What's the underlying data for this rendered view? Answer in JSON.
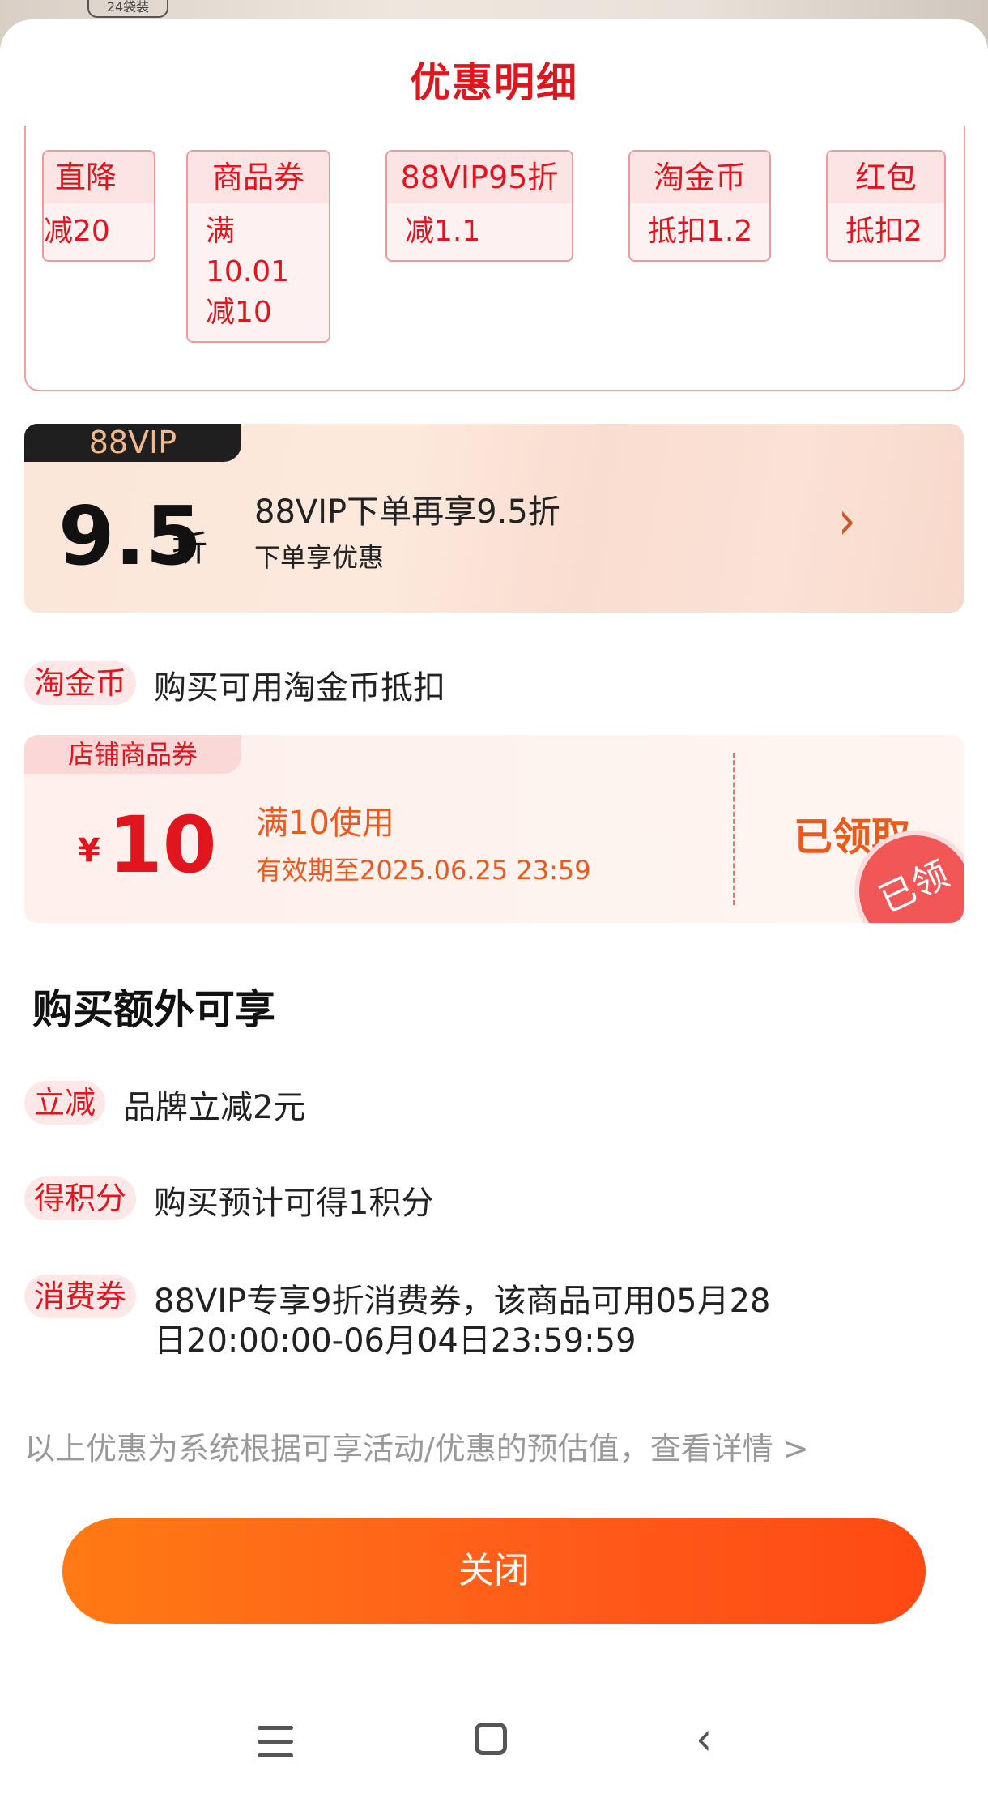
{
  "background_strip": {
    "tag": "24袋装"
  },
  "sheet": {
    "title": "优惠明细"
  },
  "discount_chips": [
    {
      "name": "直降",
      "lines": [
        "减20"
      ]
    },
    {
      "name": "商品券",
      "lines": [
        "满10.01",
        "减10"
      ]
    },
    {
      "name": "88VIP95折",
      "lines": [
        "减1.1"
      ]
    },
    {
      "name": "淘金币",
      "lines": [
        "抵扣1.2"
      ]
    },
    {
      "name": "红包",
      "lines": [
        "抵扣2"
      ]
    }
  ],
  "vip_card": {
    "badge": "88VIP",
    "discount": "9.5",
    "unit": "折",
    "headline": "88VIP下单再享9.5折",
    "subline": "下单享优惠",
    "chevron_icon": "chevron-right-icon"
  },
  "taojinbi": {
    "tag": "淘金币",
    "text": "购买可用淘金币抵扣"
  },
  "coupon": {
    "tag": "店铺商品券",
    "currency": "¥",
    "amount": "10",
    "condition": "满10使用",
    "expiry": "有效期至2025.06.25 23:59",
    "status": "已领取",
    "stamp": "已领"
  },
  "extra": {
    "heading": "购买额外可享",
    "items": [
      {
        "tag": "立减",
        "lines": [
          "品牌立减2元"
        ]
      },
      {
        "tag": "得积分",
        "lines": [
          "购买预计可得1积分"
        ]
      },
      {
        "tag": "消费券",
        "lines": [
          "88VIP专享9折消费券，该商品可用05月28",
          "日20:00:00-06月04日23:59:59"
        ]
      }
    ]
  },
  "footnote": "以上优惠为系统根据可享活动/优惠的预估值，查看详情 >",
  "close_button": "关闭",
  "nav_bar": {
    "icons": [
      "menu-icon",
      "home-icon",
      "back-icon"
    ]
  },
  "colors": {
    "accent": "#e0151d",
    "button_start": "#ff7a14",
    "button_end": "#ff4a12",
    "coupon_text": "#ea5a1d"
  }
}
